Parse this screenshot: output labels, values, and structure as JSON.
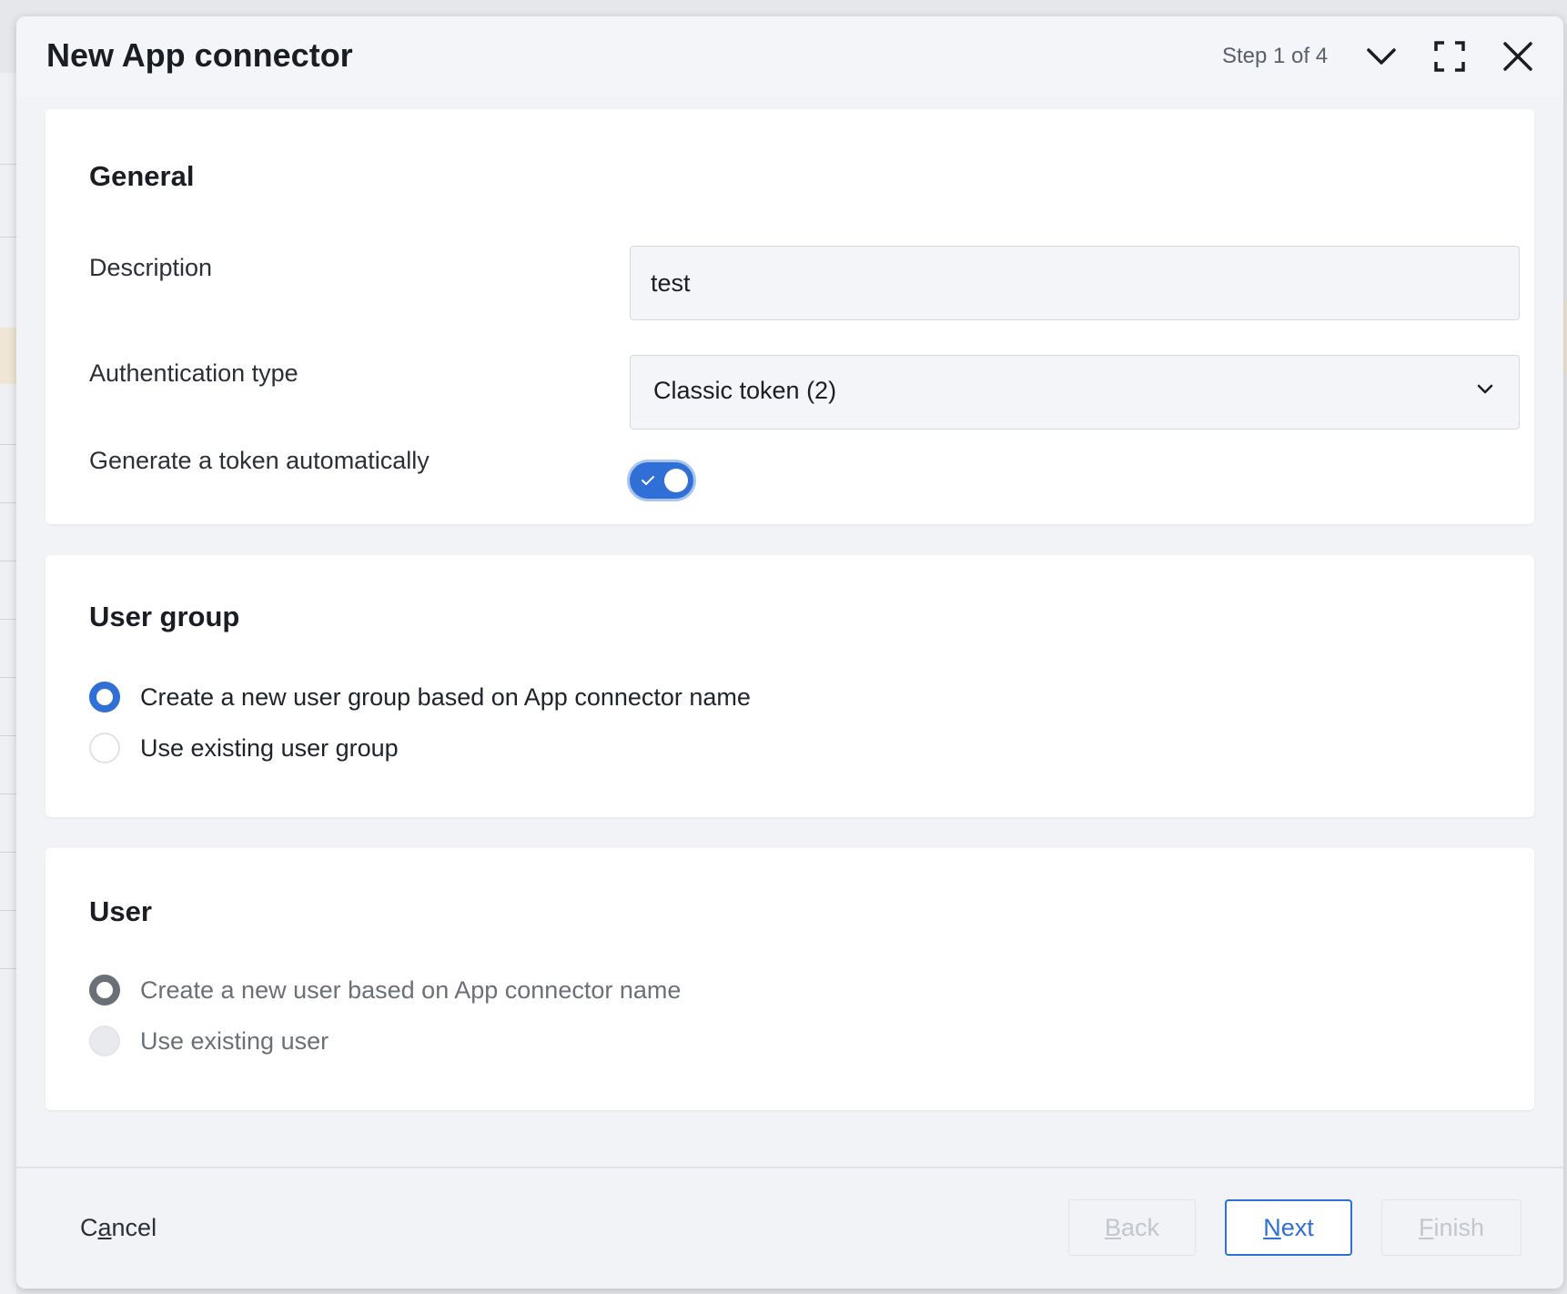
{
  "modal": {
    "title": "New App connector",
    "step": "Step 1 of 4"
  },
  "header_icons": {
    "collapse": "chevron-down-icon",
    "maximize": "maximize-icon",
    "close": "close-icon"
  },
  "general": {
    "title": "General",
    "description_label": "Description",
    "description_value": "test",
    "auth_type_label": "Authentication type",
    "auth_type_value": "Classic token (2)",
    "generate_token_label": "Generate a token automatically",
    "generate_token_on": true
  },
  "user_group": {
    "title": "User group",
    "options": [
      {
        "label": "Create a new user group based on App connector name",
        "selected": true
      },
      {
        "label": "Use existing user group",
        "selected": false
      }
    ]
  },
  "user": {
    "title": "User",
    "options": [
      {
        "label": "Create a new user based on App connector name",
        "selected": true,
        "disabled": true
      },
      {
        "label": "Use existing user",
        "selected": false,
        "disabled": true
      }
    ]
  },
  "footer": {
    "cancel": {
      "pre": "C",
      "mnemonic": "a",
      "post": "ncel"
    },
    "back": {
      "mnemonic": "B",
      "post": "ack"
    },
    "next": {
      "mnemonic": "N",
      "post": "ext"
    },
    "finish": {
      "mnemonic": "F",
      "post": "inish"
    }
  },
  "colors": {
    "accent": "#2f6fd6",
    "background": "#f2f3f6",
    "card": "#ffffff"
  }
}
